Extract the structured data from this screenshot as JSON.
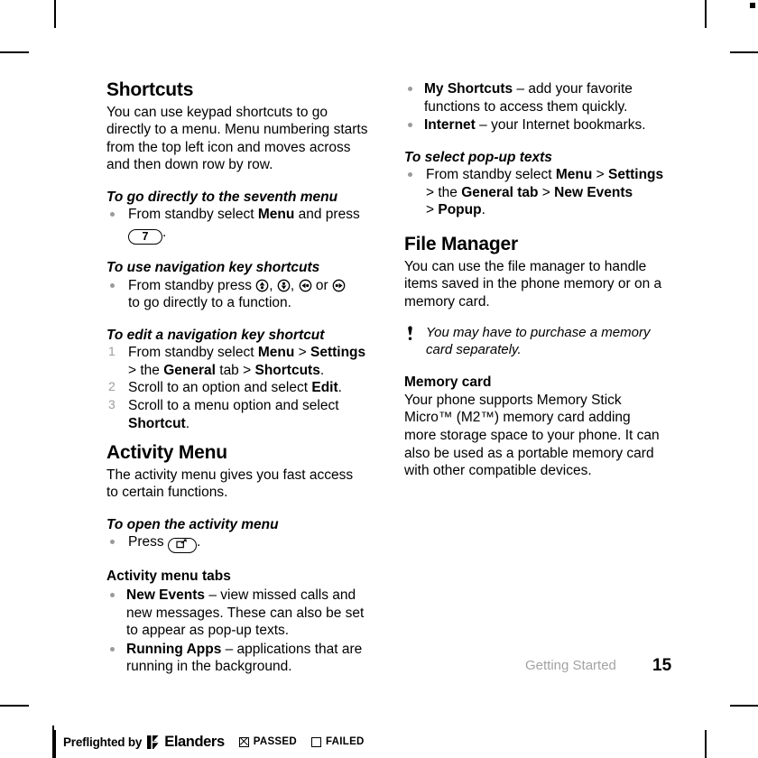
{
  "document": {
    "section_label": "Getting Started",
    "page_number": "15"
  },
  "left_column": {
    "shortcuts": {
      "heading": "Shortcuts",
      "intro": "You can use keypad shortcuts to go directly to a menu. Menu numbering starts from the top left icon and moves across and then down row by row.",
      "task1": {
        "title": "To go directly to the seventh menu",
        "step_a": "From standby select ",
        "step_menu": "Menu",
        "step_b": " and press ",
        "key_label": "7",
        "step_c": "."
      },
      "task2": {
        "title": "To use navigation key shortcuts",
        "step_a": "From standby press ",
        "sep1": ", ",
        "sep2": ", ",
        "sep3": " or ",
        "step_b": "to go directly to a function.",
        "keys": [
          "nav-up-key-icon",
          "nav-down-key-icon",
          "nav-left-key-icon",
          "nav-right-key-icon"
        ]
      },
      "task3": {
        "title": "To edit a navigation key shortcut",
        "steps": [
          {
            "num": "1",
            "t1": "From standby select ",
            "b1": "Menu",
            "t2": " > ",
            "b2": "Settings",
            "t3": " > the ",
            "b3": "General",
            "t4": " tab > ",
            "b4": "Shortcuts",
            "t5": "."
          },
          {
            "num": "2",
            "t1": "Scroll to an option and select ",
            "b1": "Edit",
            "t2": "."
          },
          {
            "num": "3",
            "t1": "Scroll to a menu option and select ",
            "b1": "Shortcut",
            "t2": "."
          }
        ]
      }
    },
    "activity_menu": {
      "heading": "Activity Menu",
      "intro": "The activity menu gives you fast access to certain functions.",
      "task": {
        "title": "To open the activity menu",
        "step_a": "Press ",
        "key_icon": "activity-menu-key-icon",
        "step_b": "."
      },
      "tabs_title": "Activity menu tabs",
      "tabs": [
        {
          "name": "New Events",
          "desc": " – view missed calls and new messages. These can also be set to appear as pop-up texts."
        },
        {
          "name": "Running Apps",
          "desc": " – applications that are running in the background."
        }
      ]
    }
  },
  "right_column": {
    "tabs_continued": [
      {
        "name": "My Shortcuts",
        "desc": " – add your favorite functions to access them quickly."
      },
      {
        "name": "Internet",
        "desc": " – your Internet bookmarks."
      }
    ],
    "popup_task": {
      "title": "To select pop-up texts",
      "t1": "From standby select ",
      "b1": "Menu",
      "t2": " > ",
      "b2": "Settings",
      "t3": " > the ",
      "b3": "General tab",
      "t4": " > ",
      "b4": "New Events",
      "t5": " > ",
      "b5": "Popup",
      "t6": "."
    },
    "file_manager": {
      "heading": "File Manager",
      "intro": "You can use the file manager to handle items saved in the phone memory or on a memory card.",
      "note": "You may have to purchase a memory card separately.",
      "memory_card": {
        "title": "Memory card",
        "body": "Your phone supports Memory Stick Micro™ (M2™) memory card adding more storage space to your phone. It can also be used as a portable memory card with other compatible devices."
      }
    }
  },
  "preflight": {
    "text": "Preflighted by",
    "brand": "Elanders",
    "passed_label": "PASSED",
    "failed_label": "FAILED"
  }
}
